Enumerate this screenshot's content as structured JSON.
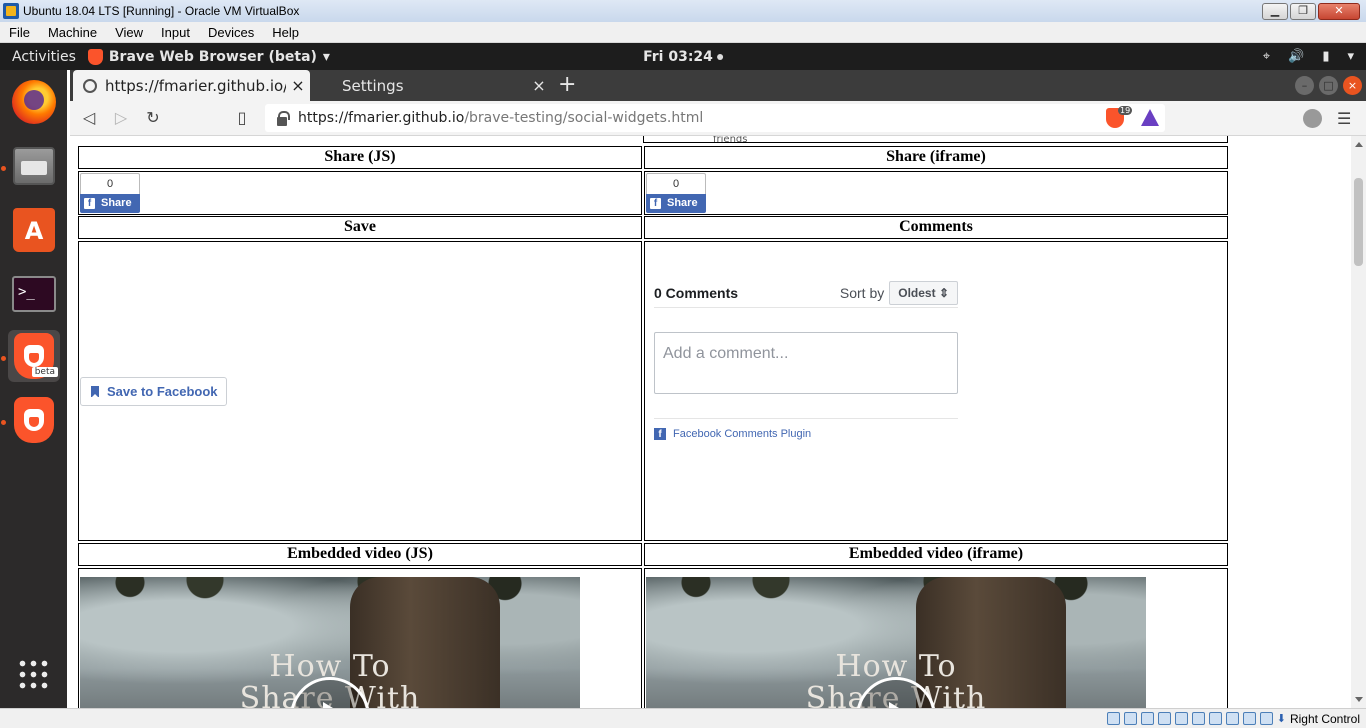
{
  "vbox": {
    "title": "Ubuntu 18.04 LTS [Running] - Oracle VM VirtualBox",
    "menu": [
      "File",
      "Machine",
      "View",
      "Input",
      "Devices",
      "Help"
    ],
    "host_key": "Right Control"
  },
  "ubuntu": {
    "activities": "Activities",
    "app_menu": "Brave Web Browser (beta)",
    "clock": "Fri 03:24"
  },
  "browser": {
    "tabs": [
      {
        "label": "https://fmarier.github.io/b",
        "active": true
      },
      {
        "label": "Settings",
        "active": false
      }
    ],
    "url_host": "https://fmarier.github.io",
    "url_path": "/brave-testing/social-widgets.html",
    "shield_count": "19"
  },
  "page": {
    "top_fragment": "friends",
    "headers": {
      "share_js": "Share (JS)",
      "share_iframe": "Share (iframe)",
      "save": "Save",
      "comments": "Comments",
      "video_js": "Embedded video (JS)",
      "video_iframe": "Embedded video (iframe)"
    },
    "share_widget": {
      "count": "0",
      "label": "Share"
    },
    "save_widget": {
      "label": "Save to Facebook"
    },
    "comments_widget": {
      "count_label": "0 Comments",
      "sort_label": "Sort by",
      "sort_value": "Oldest",
      "placeholder": "Add a comment...",
      "footer": "Facebook Comments Plugin"
    },
    "video": {
      "title_line1": "How To",
      "title_line2": "Share With"
    }
  }
}
